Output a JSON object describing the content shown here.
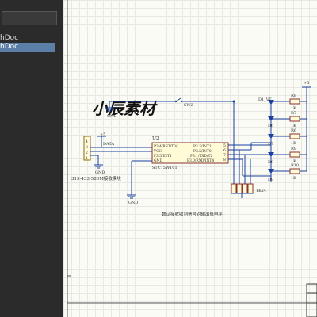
{
  "panel": {
    "items": [
      {
        "label": "hDoc",
        "selected": false
      },
      {
        "label": "hDoc",
        "selected": true
      }
    ]
  },
  "schematic": {
    "watermark": "小辰素材",
    "ic": {
      "ref": "U2",
      "part": "STC15W101",
      "left_pins": [
        "P3.4/RST/T0/",
        "VCC",
        "P3.5/INT1",
        "GND"
      ],
      "right_pins": [
        "P3.3/INT1",
        "P3.2/INT0",
        "P3.1/TXD/T2",
        "P3.0/RXD/INT4"
      ],
      "right_pin_numbers": [
        "5",
        "6",
        "7",
        "8"
      ]
    },
    "switch": {
      "ref": "SW2"
    },
    "power": {
      "label_left": "+5",
      "label_right": "+5"
    },
    "ground_labels": [
      "GND",
      "GND",
      "GND"
    ],
    "connector": {
      "pins": [
        "4",
        "3",
        "2",
        "1"
      ],
      "net": "DATA",
      "caption": "315-433-580M接收模块"
    },
    "resistor_pack": {
      "label": "1Kx4"
    },
    "leds": [
      "D1_VT",
      "D6",
      "D7",
      "D8",
      "D9"
    ],
    "resistors": [
      {
        "ref": "R8",
        "value": "1K"
      },
      {
        "ref": "R7",
        "value": "1K"
      },
      {
        "ref": "R6",
        "value": "1K"
      },
      {
        "ref": "R9",
        "value": "1K"
      },
      {
        "ref": "R10",
        "value": "1K"
      }
    ],
    "note": "数认接收收到信号对输出低电平"
  }
}
